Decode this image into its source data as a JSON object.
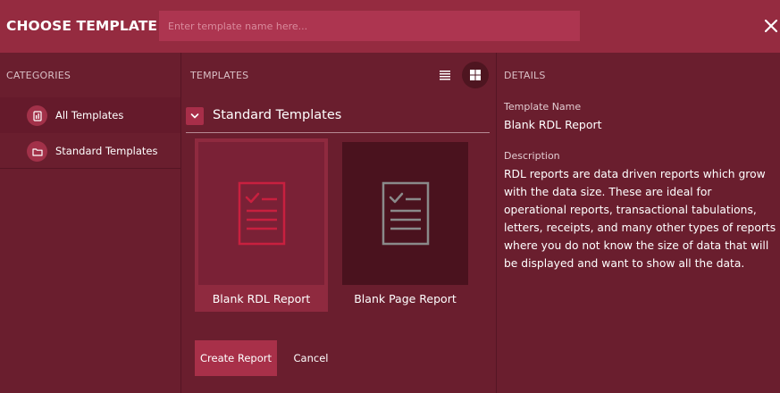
{
  "header": {
    "title": "CHOOSE TEMPLATE",
    "search_placeholder": "Enter template name here...",
    "search_value": "",
    "close_icon": "close-icon"
  },
  "categories": {
    "title": "CATEGORIES",
    "items": [
      {
        "label": "All Templates",
        "icon": "report-icon",
        "active": true
      },
      {
        "label": "Standard Templates",
        "icon": "folder-icon",
        "active": false
      }
    ]
  },
  "templates": {
    "title": "TEMPLATES",
    "view_modes": [
      {
        "name": "list-view",
        "icon": "list-icon",
        "active": false
      },
      {
        "name": "grid-view",
        "icon": "grid-icon",
        "active": true
      }
    ],
    "group": {
      "label": "Standard Templates",
      "icon": "chevron-down-icon",
      "expanded": true
    },
    "items": [
      {
        "label": "Blank RDL Report",
        "icon": "checklist-document-icon",
        "selected": true
      },
      {
        "label": "Blank Page Report",
        "icon": "checklist-document-icon",
        "selected": false
      }
    ]
  },
  "details": {
    "title": "DETAILS",
    "name_label": "Template Name",
    "name_value": "Blank RDL Report",
    "description_label": "Description",
    "description_value": "RDL reports are data driven reports which grow with the data size. These are ideal for operational reports, transactional tabulations, letters, receipts, and many other types of reports where you do not know the size of data that will be displayed and want to show all the data."
  },
  "actions": {
    "create_label": "Create Report",
    "cancel_label": "Cancel"
  },
  "colors": {
    "header_bg": "#952b40",
    "body_bg": "#6a1e2e",
    "accent": "#a83049",
    "selected_icon": "#c8203f",
    "muted_icon": "#8a8a8a"
  }
}
